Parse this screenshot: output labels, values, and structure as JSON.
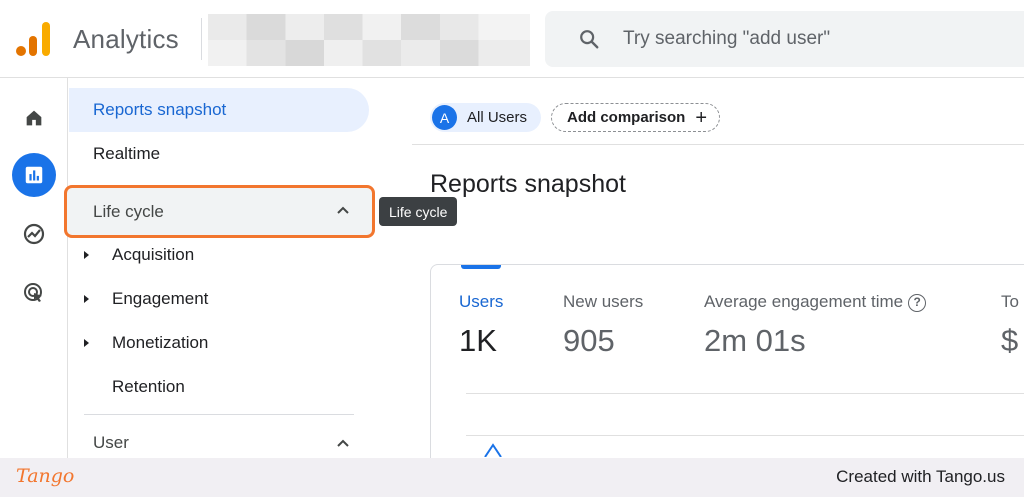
{
  "app": {
    "title": "Analytics",
    "colors": {
      "logo_orange": "#e37400",
      "logo_yellow": "#f9ab00",
      "accent": "#1a73e8"
    }
  },
  "search": {
    "placeholder": "Try searching \"add user\"",
    "icon": "search-icon"
  },
  "rail": {
    "items": [
      {
        "name": "home-icon",
        "active": false
      },
      {
        "name": "reports-icon",
        "active": true
      },
      {
        "name": "explore-icon",
        "active": false
      },
      {
        "name": "advertising-icon",
        "active": false
      }
    ]
  },
  "nav": {
    "reports_snapshot": "Reports snapshot",
    "realtime": "Realtime",
    "lifecycle": "Life cycle",
    "lifecycle_items": [
      "Acquisition",
      "Engagement",
      "Monetization",
      "Retention"
    ],
    "user": "User"
  },
  "tooltip": "Life cycle",
  "main": {
    "chip_all_avatar": "A",
    "chip_all": "All Users",
    "chip_add": "Add comparison",
    "title": "Reports snapshot",
    "metrics": [
      {
        "label": "Users",
        "value": "1K",
        "active": true
      },
      {
        "label": "New users",
        "value": "905",
        "active": false
      },
      {
        "label": "Average engagement time",
        "value": "2m 01s",
        "active": false
      },
      {
        "label": "To",
        "value": "$",
        "active": false
      }
    ]
  },
  "footer": {
    "brand": "Tango",
    "created": "Created with Tango.us"
  }
}
